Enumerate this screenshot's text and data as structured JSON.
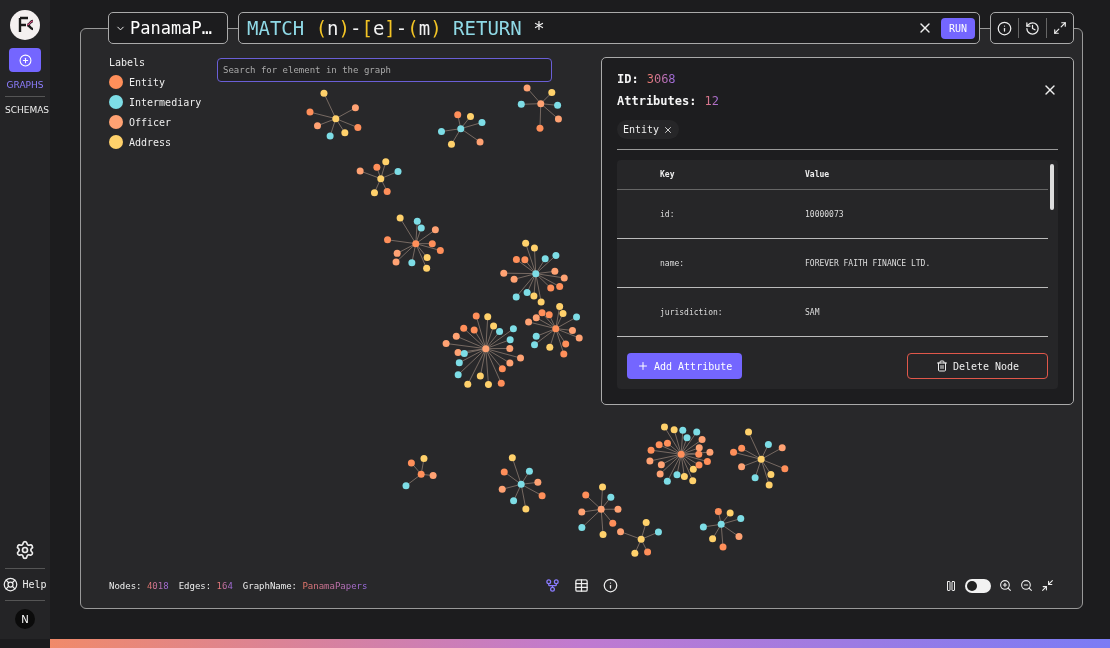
{
  "sidebar": {
    "items": [
      {
        "label": "GRAPHS",
        "selected": true
      },
      {
        "label": "SCHEMAS",
        "selected": false
      }
    ],
    "help": "Help",
    "avatar": "N"
  },
  "header": {
    "graph_name": "PanamaP…",
    "query": [
      {
        "text": "MATCH ",
        "kind": "keyword"
      },
      {
        "text": "(",
        "kind": "bracket"
      },
      {
        "text": "n",
        "kind": "plain"
      },
      {
        "text": ")",
        "kind": "bracket"
      },
      {
        "text": "-",
        "kind": "plain"
      },
      {
        "text": "[",
        "kind": "bracket"
      },
      {
        "text": "e",
        "kind": "plain"
      },
      {
        "text": "]",
        "kind": "bracket"
      },
      {
        "text": "-",
        "kind": "plain"
      },
      {
        "text": "(",
        "kind": "bracket"
      },
      {
        "text": "m",
        "kind": "plain"
      },
      {
        "text": ")",
        "kind": "bracket"
      },
      {
        "text": " RETURN",
        "kind": "keyword"
      },
      {
        "text": " *",
        "kind": "plain"
      }
    ],
    "run": "RUN"
  },
  "legend": {
    "title": "Labels",
    "labels": [
      {
        "name": "Entity",
        "color": "#ff8f5a"
      },
      {
        "name": "Intermediary",
        "color": "#7ddde6"
      },
      {
        "name": "Officer",
        "color": "#ffa273"
      },
      {
        "name": "Address",
        "color": "#ffd16b"
      }
    ]
  },
  "search": {
    "placeholder": "Search for element in the graph"
  },
  "node_panel": {
    "id_label": "ID:",
    "id": "3068",
    "attributes_label": "Attributes:",
    "attributes": "12",
    "chips": [
      "Entity"
    ],
    "columns": [
      "Key",
      "Value"
    ],
    "rows": [
      {
        "key": "id:",
        "value": "10000073"
      },
      {
        "key": "name:",
        "value": "FOREVER FAITH FINANCE LTD."
      },
      {
        "key": "jurisdiction:",
        "value": "SAM"
      }
    ],
    "add": "Add Attribute",
    "delete": "Delete Node"
  },
  "footer": {
    "stats": [
      {
        "label": "Nodes:",
        "value": "4018"
      },
      {
        "label": "Edges:",
        "value": "164"
      },
      {
        "label": "GraphName:",
        "value": "PanamaPapers"
      }
    ],
    "views": [
      {
        "kind": "graph",
        "selected": true
      },
      {
        "kind": "table",
        "selected": false
      },
      {
        "kind": "info",
        "selected": false
      }
    ],
    "animation_on": false
  }
}
